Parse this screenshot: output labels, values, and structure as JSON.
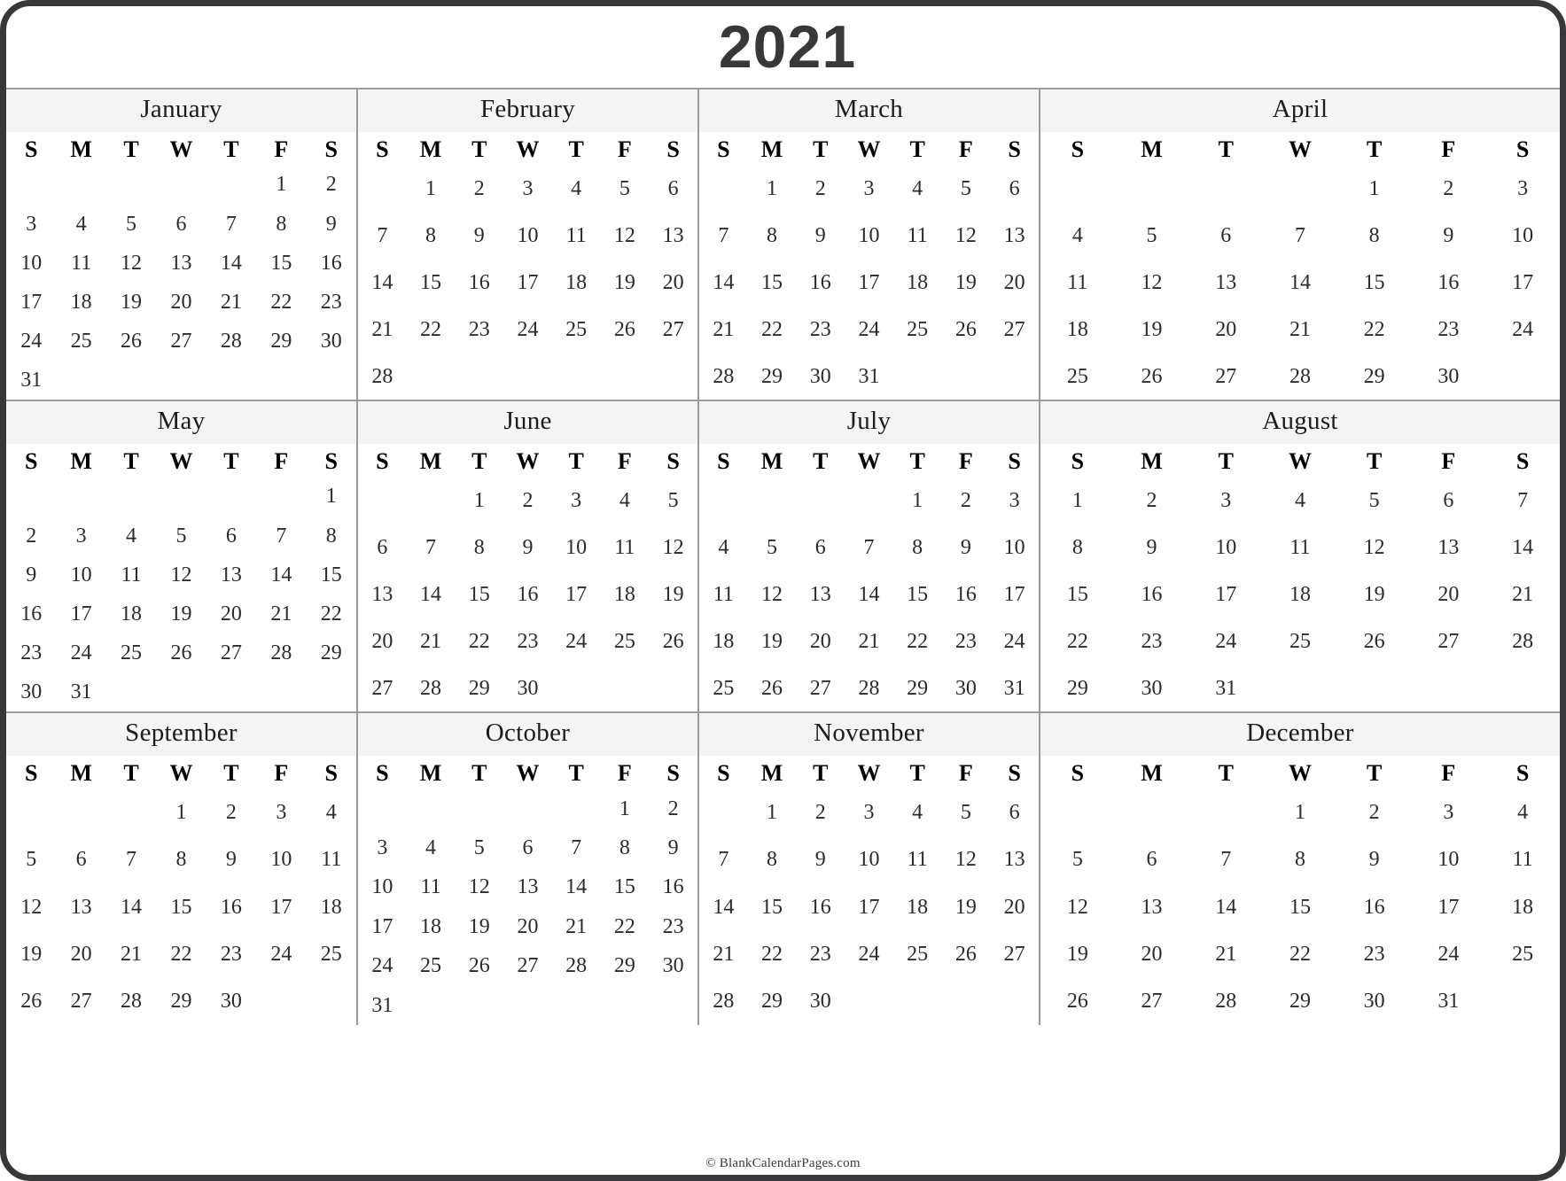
{
  "page": {
    "year_title": "2021",
    "footer_text": "© BlankCalendarPages.com",
    "accent_frame_color": "#38383a",
    "grid_line_color": "#9a9a9a",
    "month_header_bg": "#f4f4f4"
  },
  "weekday_headers": [
    "S",
    "M",
    "T",
    "W",
    "T",
    "F",
    "S"
  ],
  "months": [
    {
      "name": "January",
      "first_weekday_index": 5,
      "days_in_month": 31,
      "weeks": [
        [
          "",
          "",
          "",
          "",
          "",
          "1",
          "2"
        ],
        [
          "3",
          "4",
          "5",
          "6",
          "7",
          "8",
          "9"
        ],
        [
          "10",
          "11",
          "12",
          "13",
          "14",
          "15",
          "16"
        ],
        [
          "17",
          "18",
          "19",
          "20",
          "21",
          "22",
          "23"
        ],
        [
          "24",
          "25",
          "26",
          "27",
          "28",
          "29",
          "30"
        ],
        [
          "31",
          "",
          "",
          "",
          "",
          "",
          ""
        ]
      ]
    },
    {
      "name": "February",
      "first_weekday_index": 1,
      "days_in_month": 28,
      "weeks": [
        [
          "",
          "1",
          "2",
          "3",
          "4",
          "5",
          "6"
        ],
        [
          "7",
          "8",
          "9",
          "10",
          "11",
          "12",
          "13"
        ],
        [
          "14",
          "15",
          "16",
          "17",
          "18",
          "19",
          "20"
        ],
        [
          "21",
          "22",
          "23",
          "24",
          "25",
          "26",
          "27"
        ],
        [
          "28",
          "",
          "",
          "",
          "",
          "",
          ""
        ]
      ]
    },
    {
      "name": "March",
      "first_weekday_index": 1,
      "days_in_month": 31,
      "weeks": [
        [
          "",
          "1",
          "2",
          "3",
          "4",
          "5",
          "6"
        ],
        [
          "7",
          "8",
          "9",
          "10",
          "11",
          "12",
          "13"
        ],
        [
          "14",
          "15",
          "16",
          "17",
          "18",
          "19",
          "20"
        ],
        [
          "21",
          "22",
          "23",
          "24",
          "25",
          "26",
          "27"
        ],
        [
          "28",
          "29",
          "30",
          "31",
          "",
          "",
          ""
        ]
      ]
    },
    {
      "name": "April",
      "first_weekday_index": 4,
      "days_in_month": 30,
      "weeks": [
        [
          "",
          "",
          "",
          "",
          "1",
          "2",
          "3"
        ],
        [
          "4",
          "5",
          "6",
          "7",
          "8",
          "9",
          "10"
        ],
        [
          "11",
          "12",
          "13",
          "14",
          "15",
          "16",
          "17"
        ],
        [
          "18",
          "19",
          "20",
          "21",
          "22",
          "23",
          "24"
        ],
        [
          "25",
          "26",
          "27",
          "28",
          "29",
          "30",
          ""
        ]
      ]
    },
    {
      "name": "May",
      "first_weekday_index": 6,
      "days_in_month": 31,
      "weeks": [
        [
          "",
          "",
          "",
          "",
          "",
          "",
          "1"
        ],
        [
          "2",
          "3",
          "4",
          "5",
          "6",
          "7",
          "8"
        ],
        [
          "9",
          "10",
          "11",
          "12",
          "13",
          "14",
          "15"
        ],
        [
          "16",
          "17",
          "18",
          "19",
          "20",
          "21",
          "22"
        ],
        [
          "23",
          "24",
          "25",
          "26",
          "27",
          "28",
          "29"
        ],
        [
          "30",
          "31",
          "",
          "",
          "",
          "",
          ""
        ]
      ]
    },
    {
      "name": "June",
      "first_weekday_index": 2,
      "days_in_month": 30,
      "weeks": [
        [
          "",
          "",
          "1",
          "2",
          "3",
          "4",
          "5"
        ],
        [
          "6",
          "7",
          "8",
          "9",
          "10",
          "11",
          "12"
        ],
        [
          "13",
          "14",
          "15",
          "16",
          "17",
          "18",
          "19"
        ],
        [
          "20",
          "21",
          "22",
          "23",
          "24",
          "25",
          "26"
        ],
        [
          "27",
          "28",
          "29",
          "30",
          "",
          "",
          ""
        ]
      ]
    },
    {
      "name": "July",
      "first_weekday_index": 4,
      "days_in_month": 31,
      "weeks": [
        [
          "",
          "",
          "",
          "",
          "1",
          "2",
          "3"
        ],
        [
          "4",
          "5",
          "6",
          "7",
          "8",
          "9",
          "10"
        ],
        [
          "11",
          "12",
          "13",
          "14",
          "15",
          "16",
          "17"
        ],
        [
          "18",
          "19",
          "20",
          "21",
          "22",
          "23",
          "24"
        ],
        [
          "25",
          "26",
          "27",
          "28",
          "29",
          "30",
          "31"
        ]
      ]
    },
    {
      "name": "August",
      "first_weekday_index": 0,
      "days_in_month": 31,
      "weeks": [
        [
          "1",
          "2",
          "3",
          "4",
          "5",
          "6",
          "7"
        ],
        [
          "8",
          "9",
          "10",
          "11",
          "12",
          "13",
          "14"
        ],
        [
          "15",
          "16",
          "17",
          "18",
          "19",
          "20",
          "21"
        ],
        [
          "22",
          "23",
          "24",
          "25",
          "26",
          "27",
          "28"
        ],
        [
          "29",
          "30",
          "31",
          "",
          "",
          "",
          ""
        ]
      ]
    },
    {
      "name": "September",
      "first_weekday_index": 3,
      "days_in_month": 30,
      "weeks": [
        [
          "",
          "",
          "",
          "1",
          "2",
          "3",
          "4"
        ],
        [
          "5",
          "6",
          "7",
          "8",
          "9",
          "10",
          "11"
        ],
        [
          "12",
          "13",
          "14",
          "15",
          "16",
          "17",
          "18"
        ],
        [
          "19",
          "20",
          "21",
          "22",
          "23",
          "24",
          "25"
        ],
        [
          "26",
          "27",
          "28",
          "29",
          "30",
          "",
          ""
        ]
      ]
    },
    {
      "name": "October",
      "first_weekday_index": 5,
      "days_in_month": 31,
      "weeks": [
        [
          "",
          "",
          "",
          "",
          "",
          "1",
          "2"
        ],
        [
          "3",
          "4",
          "5",
          "6",
          "7",
          "8",
          "9"
        ],
        [
          "10",
          "11",
          "12",
          "13",
          "14",
          "15",
          "16"
        ],
        [
          "17",
          "18",
          "19",
          "20",
          "21",
          "22",
          "23"
        ],
        [
          "24",
          "25",
          "26",
          "27",
          "28",
          "29",
          "30"
        ],
        [
          "31",
          "",
          "",
          "",
          "",
          "",
          ""
        ]
      ]
    },
    {
      "name": "November",
      "first_weekday_index": 1,
      "days_in_month": 30,
      "weeks": [
        [
          "",
          "1",
          "2",
          "3",
          "4",
          "5",
          "6"
        ],
        [
          "7",
          "8",
          "9",
          "10",
          "11",
          "12",
          "13"
        ],
        [
          "14",
          "15",
          "16",
          "17",
          "18",
          "19",
          "20"
        ],
        [
          "21",
          "22",
          "23",
          "24",
          "25",
          "26",
          "27"
        ],
        [
          "28",
          "29",
          "30",
          "",
          "",
          "",
          ""
        ]
      ]
    },
    {
      "name": "December",
      "first_weekday_index": 3,
      "days_in_month": 31,
      "weeks": [
        [
          "",
          "",
          "",
          "1",
          "2",
          "3",
          "4"
        ],
        [
          "5",
          "6",
          "7",
          "8",
          "9",
          "10",
          "11"
        ],
        [
          "12",
          "13",
          "14",
          "15",
          "16",
          "17",
          "18"
        ],
        [
          "19",
          "20",
          "21",
          "22",
          "23",
          "24",
          "25"
        ],
        [
          "26",
          "27",
          "28",
          "29",
          "30",
          "31",
          ""
        ]
      ]
    }
  ]
}
